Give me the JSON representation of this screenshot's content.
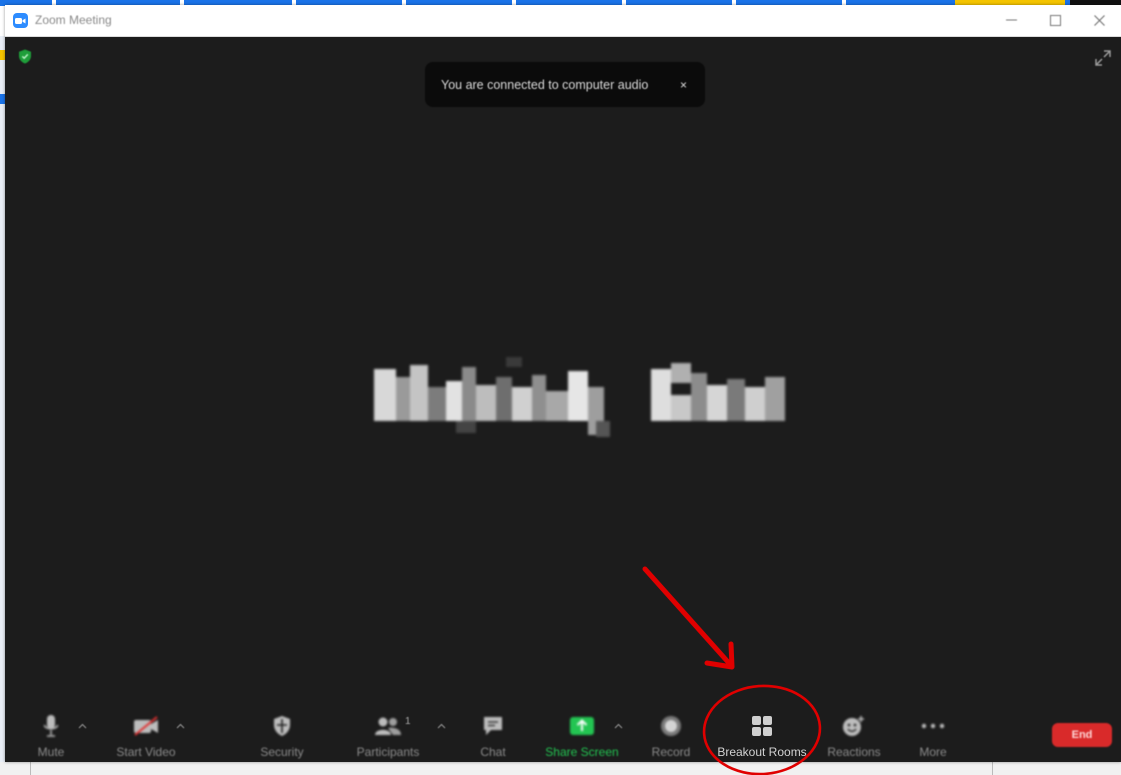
{
  "window": {
    "title": "Zoom Meeting",
    "minimize_icon": "minimize-icon",
    "maximize_icon": "maximize-icon",
    "close_icon": "close-icon"
  },
  "toast": {
    "message": "You are connected to computer audio",
    "close_label": "×"
  },
  "toolbar": {
    "mute": {
      "label": "Mute",
      "icon": "microphone-icon"
    },
    "start_video": {
      "label": "Start Video",
      "icon": "video-off-icon"
    },
    "security": {
      "label": "Security",
      "icon": "shield-icon"
    },
    "participants": {
      "label": "Participants",
      "icon": "people-icon",
      "count": "1"
    },
    "chat": {
      "label": "Chat",
      "icon": "chat-bubble-icon"
    },
    "share_screen": {
      "label": "Share Screen",
      "icon": "share-up-arrow-icon"
    },
    "record": {
      "label": "Record",
      "icon": "record-icon"
    },
    "breakout_rooms": {
      "label": "Breakout Rooms",
      "icon": "grid-icon"
    },
    "reactions": {
      "label": "Reactions",
      "icon": "emoji-add-icon"
    },
    "more": {
      "label": "More",
      "icon": "ellipsis-icon"
    },
    "end": {
      "label": "End"
    }
  },
  "colors": {
    "meeting_background": "#1c1c1c",
    "share_green": "#23c552",
    "end_red": "#d92a2a",
    "annotation_red": "#e00000",
    "zoom_blue": "#2d8cff"
  }
}
